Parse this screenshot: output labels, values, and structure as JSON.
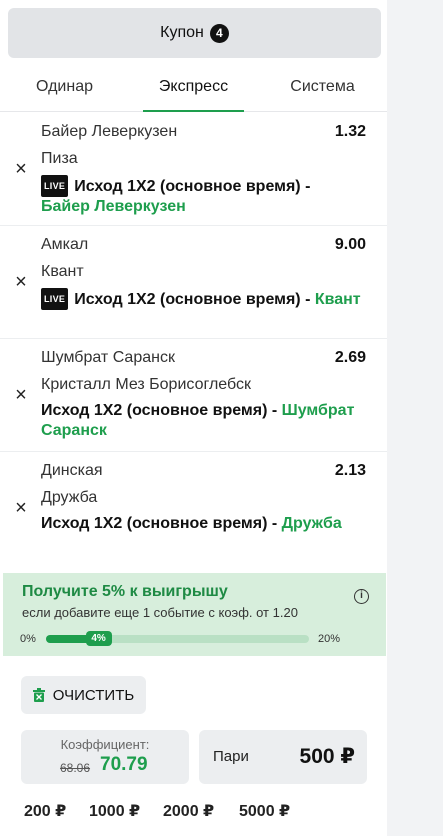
{
  "coupon": {
    "title": "Купон",
    "count": "4"
  },
  "tabs": [
    {
      "label": "Одинар",
      "active": false
    },
    {
      "label": "Экспресс",
      "active": true
    },
    {
      "label": "Система",
      "active": false
    }
  ],
  "live_label": "LIVE",
  "bets": [
    {
      "team1": "Байер Леверкузен",
      "team2": "Пиза",
      "odd": "1.32",
      "live": true,
      "market": "Исход 1Х2 (основное время) - ",
      "pick": "Байер Леверкузен"
    },
    {
      "team1": "Амкал",
      "team2": "Квант",
      "odd": "9.00",
      "live": true,
      "market": "Исход 1Х2 (основное время) - ",
      "pick": "Квант"
    },
    {
      "team1": "Шумбрат Саранск",
      "team2": "Кристалл Мез Борисоглебск",
      "odd": "2.69",
      "live": false,
      "market": "Исход 1Х2 (основное время) - ",
      "pick": "Шумбрат Саранск"
    },
    {
      "team1": "Динская",
      "team2": "Дружба",
      "odd": "2.13",
      "live": false,
      "market": "Исход 1Х2 (основное время) - ",
      "pick": "Дружба"
    }
  ],
  "promo": {
    "title": "Получите 5% к выигрышу",
    "subtitle": "если добавите еще 1 событие с коэф. от 1.20",
    "min_label": "0%",
    "max_label": "20%",
    "progress_label": "4%",
    "progress_fraction": 0.2
  },
  "footer": {
    "clear_label": "ОЧИСТИТЬ",
    "coef_label": "Коэффициент:",
    "coef_old": "68.06",
    "coef_new": "70.79",
    "stake_label": "Пари",
    "stake_value": "500 ₽",
    "quick_amounts": [
      "200 ₽",
      "1000 ₽",
      "2000 ₽",
      "5000 ₽"
    ]
  },
  "colors": {
    "accent": "#1e9e4d",
    "promo_bg": "#d7eedc"
  }
}
